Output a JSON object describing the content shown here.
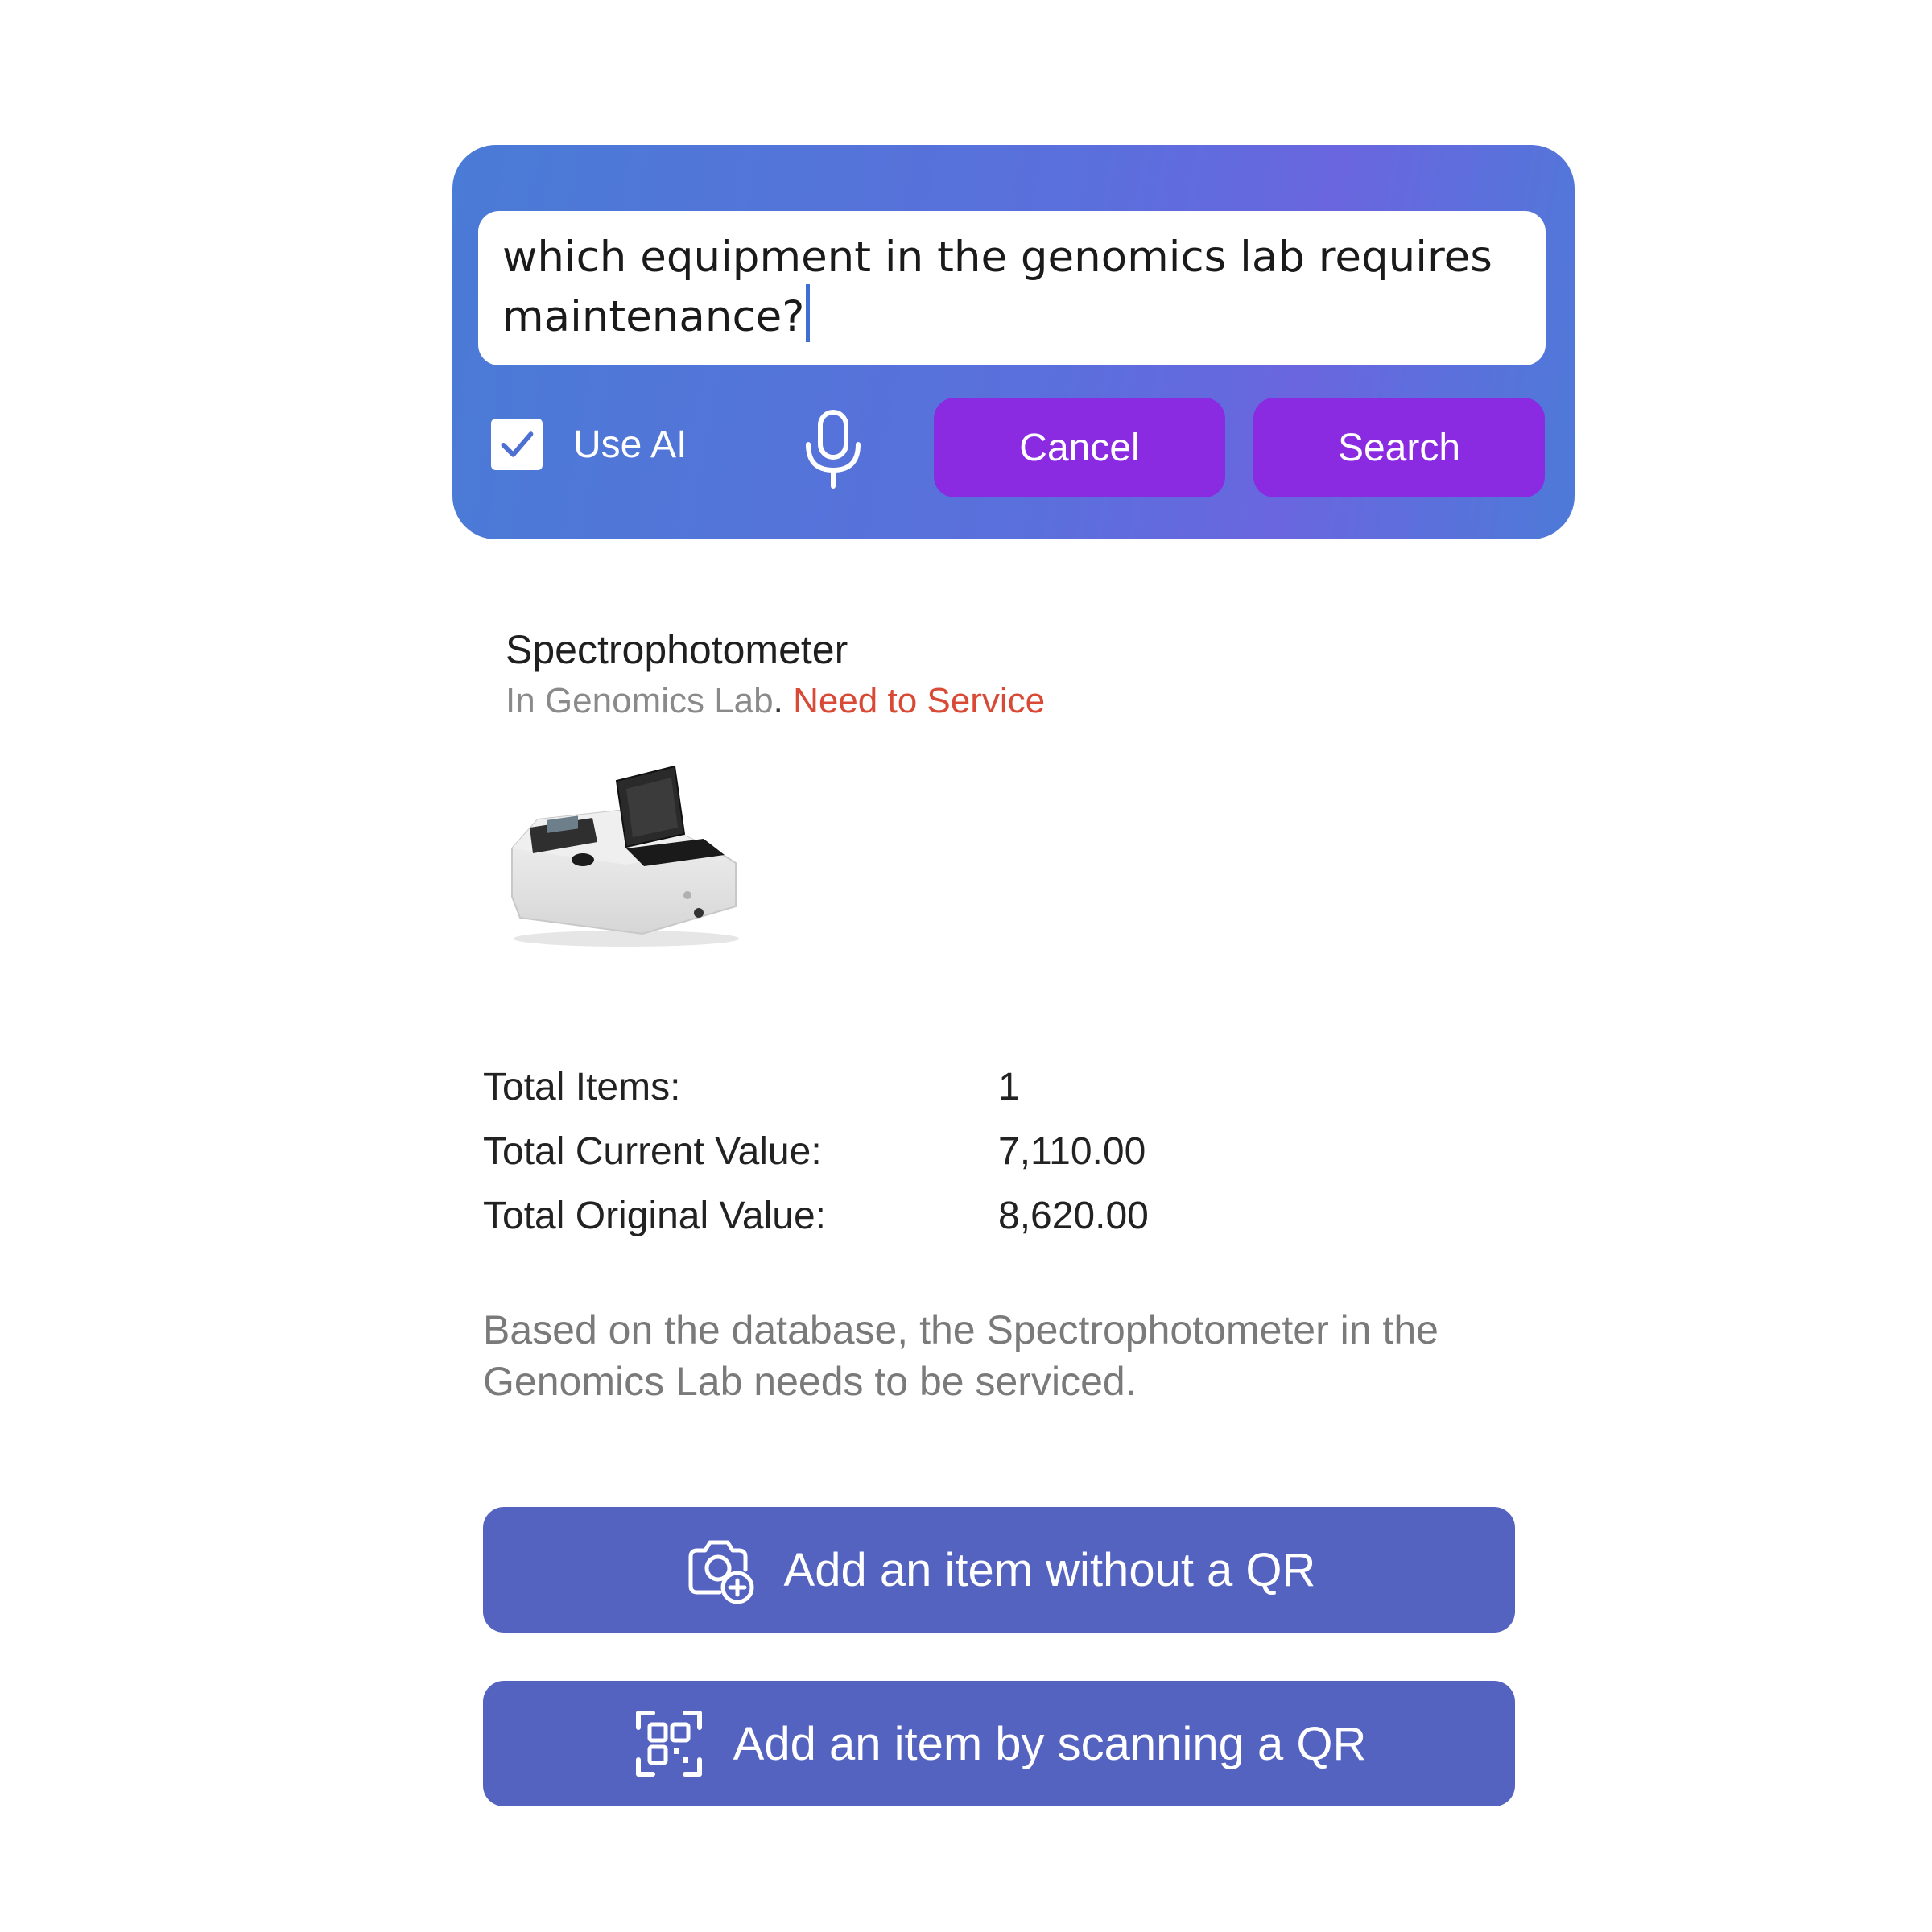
{
  "search": {
    "query": "which equipment in the genomics lab requires maintenance?",
    "use_ai_label": "Use AI",
    "use_ai_checked": true,
    "cancel_label": "Cancel",
    "search_label": "Search",
    "mic_icon": "microphone-icon"
  },
  "result": {
    "title": "Spectrophotometer",
    "location": "In Genomics Lab",
    "separator": ".",
    "status": "Need to Service",
    "image_icon": "spectrophotometer-image"
  },
  "totals": [
    {
      "label": "Total Items:",
      "value": "1"
    },
    {
      "label": "Total Current Value:",
      "value": "7,110.00"
    },
    {
      "label": "Total Original Value:",
      "value": "8,620.00"
    }
  ],
  "summary": "Based on the database, the Spectrophotometer in the Genomics Lab needs to be serviced.",
  "actions": {
    "add_without_qr": "Add an item without a QR",
    "add_by_scan": "Add an item by scanning a QR"
  },
  "colors": {
    "panel_gradient_start": "#4a7bd6",
    "panel_gradient_end": "#6a66df",
    "purple_button": "#8a2be2",
    "action_button": "#5563c0",
    "status_red": "#d94a36"
  }
}
